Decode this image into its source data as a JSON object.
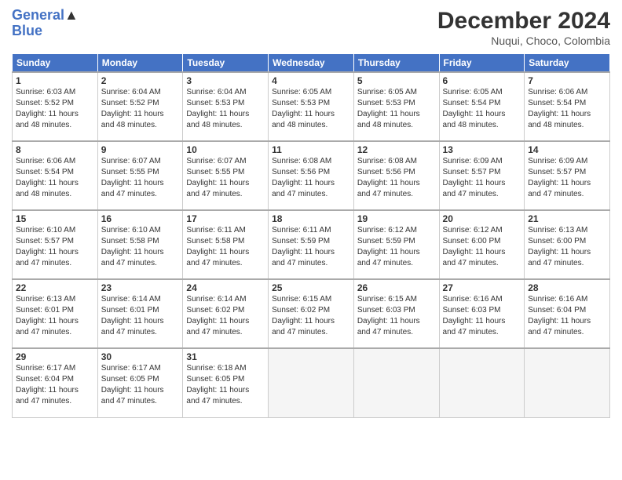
{
  "header": {
    "logo_line1": "General",
    "logo_line2": "Blue",
    "month": "December 2024",
    "location": "Nuqui, Choco, Colombia"
  },
  "days_of_week": [
    "Sunday",
    "Monday",
    "Tuesday",
    "Wednesday",
    "Thursday",
    "Friday",
    "Saturday"
  ],
  "weeks": [
    [
      {
        "num": "1",
        "rise": "6:03 AM",
        "set": "5:52 PM",
        "hours": "11 hours",
        "mins": "48"
      },
      {
        "num": "2",
        "rise": "6:04 AM",
        "set": "5:52 PM",
        "hours": "11 hours",
        "mins": "48"
      },
      {
        "num": "3",
        "rise": "6:04 AM",
        "set": "5:53 PM",
        "hours": "11 hours",
        "mins": "48"
      },
      {
        "num": "4",
        "rise": "6:05 AM",
        "set": "5:53 PM",
        "hours": "11 hours",
        "mins": "48"
      },
      {
        "num": "5",
        "rise": "6:05 AM",
        "set": "5:53 PM",
        "hours": "11 hours",
        "mins": "48"
      },
      {
        "num": "6",
        "rise": "6:05 AM",
        "set": "5:54 PM",
        "hours": "11 hours",
        "mins": "48"
      },
      {
        "num": "7",
        "rise": "6:06 AM",
        "set": "5:54 PM",
        "hours": "11 hours",
        "mins": "48"
      }
    ],
    [
      {
        "num": "8",
        "rise": "6:06 AM",
        "set": "5:54 PM",
        "hours": "11 hours",
        "mins": "48"
      },
      {
        "num": "9",
        "rise": "6:07 AM",
        "set": "5:55 PM",
        "hours": "11 hours",
        "mins": "47"
      },
      {
        "num": "10",
        "rise": "6:07 AM",
        "set": "5:55 PM",
        "hours": "11 hours",
        "mins": "47"
      },
      {
        "num": "11",
        "rise": "6:08 AM",
        "set": "5:56 PM",
        "hours": "11 hours",
        "mins": "47"
      },
      {
        "num": "12",
        "rise": "6:08 AM",
        "set": "5:56 PM",
        "hours": "11 hours",
        "mins": "47"
      },
      {
        "num": "13",
        "rise": "6:09 AM",
        "set": "5:57 PM",
        "hours": "11 hours",
        "mins": "47"
      },
      {
        "num": "14",
        "rise": "6:09 AM",
        "set": "5:57 PM",
        "hours": "11 hours",
        "mins": "47"
      }
    ],
    [
      {
        "num": "15",
        "rise": "6:10 AM",
        "set": "5:57 PM",
        "hours": "11 hours",
        "mins": "47"
      },
      {
        "num": "16",
        "rise": "6:10 AM",
        "set": "5:58 PM",
        "hours": "11 hours",
        "mins": "47"
      },
      {
        "num": "17",
        "rise": "6:11 AM",
        "set": "5:58 PM",
        "hours": "11 hours",
        "mins": "47"
      },
      {
        "num": "18",
        "rise": "6:11 AM",
        "set": "5:59 PM",
        "hours": "11 hours",
        "mins": "47"
      },
      {
        "num": "19",
        "rise": "6:12 AM",
        "set": "5:59 PM",
        "hours": "11 hours",
        "mins": "47"
      },
      {
        "num": "20",
        "rise": "6:12 AM",
        "set": "6:00 PM",
        "hours": "11 hours",
        "mins": "47"
      },
      {
        "num": "21",
        "rise": "6:13 AM",
        "set": "6:00 PM",
        "hours": "11 hours",
        "mins": "47"
      }
    ],
    [
      {
        "num": "22",
        "rise": "6:13 AM",
        "set": "6:01 PM",
        "hours": "11 hours",
        "mins": "47"
      },
      {
        "num": "23",
        "rise": "6:14 AM",
        "set": "6:01 PM",
        "hours": "11 hours",
        "mins": "47"
      },
      {
        "num": "24",
        "rise": "6:14 AM",
        "set": "6:02 PM",
        "hours": "11 hours",
        "mins": "47"
      },
      {
        "num": "25",
        "rise": "6:15 AM",
        "set": "6:02 PM",
        "hours": "11 hours",
        "mins": "47"
      },
      {
        "num": "26",
        "rise": "6:15 AM",
        "set": "6:03 PM",
        "hours": "11 hours",
        "mins": "47"
      },
      {
        "num": "27",
        "rise": "6:16 AM",
        "set": "6:03 PM",
        "hours": "11 hours",
        "mins": "47"
      },
      {
        "num": "28",
        "rise": "6:16 AM",
        "set": "6:04 PM",
        "hours": "11 hours",
        "mins": "47"
      }
    ],
    [
      {
        "num": "29",
        "rise": "6:17 AM",
        "set": "6:04 PM",
        "hours": "11 hours",
        "mins": "47"
      },
      {
        "num": "30",
        "rise": "6:17 AM",
        "set": "6:05 PM",
        "hours": "11 hours",
        "mins": "47"
      },
      {
        "num": "31",
        "rise": "6:18 AM",
        "set": "6:05 PM",
        "hours": "11 hours",
        "mins": "47"
      },
      null,
      null,
      null,
      null
    ]
  ]
}
